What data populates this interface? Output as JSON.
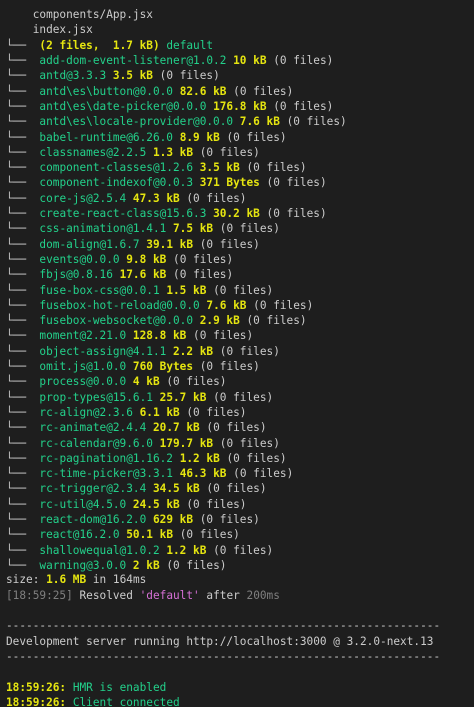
{
  "header_files": [
    "components/App.jsx",
    "index.jsx"
  ],
  "bundle_summary": {
    "tree": "└──",
    "prefix": "(",
    "files": "2 files,",
    "size": "1.7 kB",
    "suffix": ")",
    "name": "default"
  },
  "modules": [
    {
      "name": "add-dom-event-listener@1.0.2",
      "size": "10 kB",
      "files": "(0 files)"
    },
    {
      "name": "antd@3.3.3",
      "size": "3.5 kB",
      "files": "(0 files)"
    },
    {
      "name": "antd\\es\\button@0.0.0",
      "size": "82.6 kB",
      "files": "(0 files)"
    },
    {
      "name": "antd\\es\\date-picker@0.0.0",
      "size": "176.8 kB",
      "files": "(0 files)"
    },
    {
      "name": "antd\\es\\locale-provider@0.0.0",
      "size": "7.6 kB",
      "files": "(0 files)"
    },
    {
      "name": "babel-runtime@6.26.0",
      "size": "8.9 kB",
      "files": "(0 files)"
    },
    {
      "name": "classnames@2.2.5",
      "size": "1.3 kB",
      "files": "(0 files)"
    },
    {
      "name": "component-classes@1.2.6",
      "size": "3.5 kB",
      "files": "(0 files)"
    },
    {
      "name": "component-indexof@0.0.3",
      "size": "371 Bytes",
      "files": "(0 files)"
    },
    {
      "name": "core-js@2.5.4",
      "size": "47.3 kB",
      "files": "(0 files)"
    },
    {
      "name": "create-react-class@15.6.3",
      "size": "30.2 kB",
      "files": "(0 files)"
    },
    {
      "name": "css-animation@1.4.1",
      "size": "7.5 kB",
      "files": "(0 files)"
    },
    {
      "name": "dom-align@1.6.7",
      "size": "39.1 kB",
      "files": "(0 files)"
    },
    {
      "name": "events@0.0.0",
      "size": "9.8 kB",
      "files": "(0 files)"
    },
    {
      "name": "fbjs@0.8.16",
      "size": "17.6 kB",
      "files": "(0 files)"
    },
    {
      "name": "fuse-box-css@0.0.1",
      "size": "1.5 kB",
      "files": "(0 files)"
    },
    {
      "name": "fusebox-hot-reload@0.0.0",
      "size": "7.6 kB",
      "files": "(0 files)"
    },
    {
      "name": "fusebox-websocket@0.0.0",
      "size": "2.9 kB",
      "files": "(0 files)"
    },
    {
      "name": "moment@2.21.0",
      "size": "128.8 kB",
      "files": "(0 files)"
    },
    {
      "name": "object-assign@4.1.1",
      "size": "2.2 kB",
      "files": "(0 files)"
    },
    {
      "name": "omit.js@1.0.0",
      "size": "760 Bytes",
      "files": "(0 files)"
    },
    {
      "name": "process@0.0.0",
      "size": "4 kB",
      "files": "(0 files)"
    },
    {
      "name": "prop-types@15.6.1",
      "size": "25.7 kB",
      "files": "(0 files)"
    },
    {
      "name": "rc-align@2.3.6",
      "size": "6.1 kB",
      "files": "(0 files)"
    },
    {
      "name": "rc-animate@2.4.4",
      "size": "20.7 kB",
      "files": "(0 files)"
    },
    {
      "name": "rc-calendar@9.6.0",
      "size": "179.7 kB",
      "files": "(0 files)"
    },
    {
      "name": "rc-pagination@1.16.2",
      "size": "1.2 kB",
      "files": "(0 files)"
    },
    {
      "name": "rc-time-picker@3.3.1",
      "size": "46.3 kB",
      "files": "(0 files)"
    },
    {
      "name": "rc-trigger@2.3.4",
      "size": "34.5 kB",
      "files": "(0 files)"
    },
    {
      "name": "rc-util@4.5.0",
      "size": "24.5 kB",
      "files": "(0 files)"
    },
    {
      "name": "react-dom@16.2.0",
      "size": "629 kB",
      "files": "(0 files)"
    },
    {
      "name": "react@16.2.0",
      "size": "50.1 kB",
      "files": "(0 files)"
    },
    {
      "name": "shallowequal@1.0.2",
      "size": "1.2 kB",
      "files": "(0 files)"
    },
    {
      "name": "warning@3.0.0",
      "size": "2 kB",
      "files": "(0 files)"
    }
  ],
  "total": {
    "label": "size:",
    "size": "1.6 MB",
    "mid": "in",
    "time": "164ms"
  },
  "resolved": {
    "time": "[18:59:25]",
    "text": "Resolved",
    "name": "'default'",
    "after": "after",
    "dur": "200ms"
  },
  "separator": "-----------------------------------------------------------------",
  "server_msg": "Development server running http://localhost:3000 @ 3.2.0-next.13",
  "logs": [
    {
      "time": "18:59:26:",
      "msg": "HMR is enabled"
    },
    {
      "time": "18:59:26:",
      "msg": "Client connected"
    }
  ],
  "colors": {
    "background": "#1e1e1e",
    "green": "#23d18b",
    "yellow": "#e5e510",
    "gray": "#7f7f7f",
    "magenta": "#d670d6"
  }
}
